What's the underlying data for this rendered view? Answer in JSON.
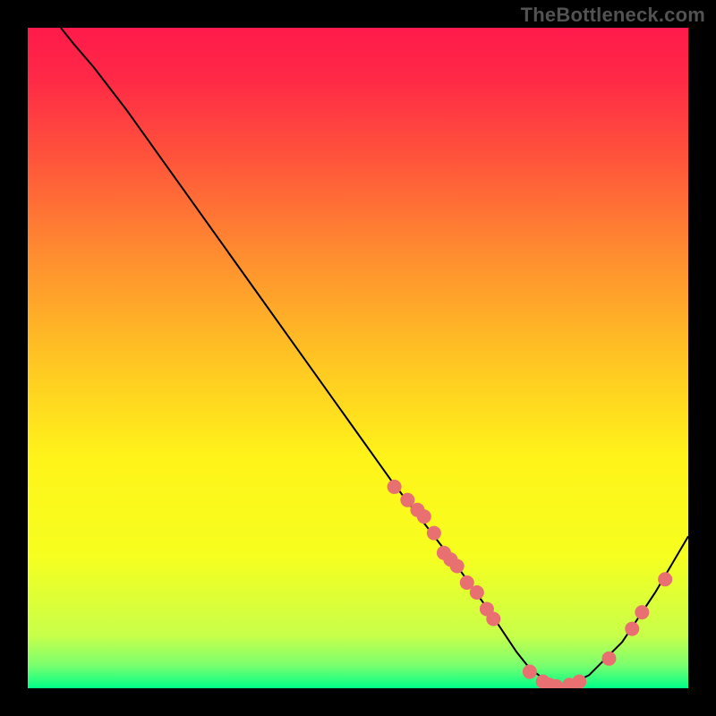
{
  "attribution": "TheBottleneck.com",
  "chart_data": {
    "type": "line",
    "title": "",
    "xlabel": "",
    "ylabel": "",
    "xlim": [
      0,
      100
    ],
    "ylim": [
      0,
      100
    ],
    "series": [
      {
        "name": "bottleneck-curve",
        "x": [
          5.0,
          7.0,
          10.0,
          15.0,
          20.0,
          25.0,
          30.0,
          35.0,
          40.0,
          45.0,
          50.0,
          55.0,
          60.0,
          65.0,
          70.0,
          72.0,
          74.0,
          76.0,
          78.0,
          80.0,
          82.0,
          85.0,
          90.0,
          95.0,
          100.0
        ],
        "y": [
          100.0,
          97.5,
          94.0,
          87.5,
          80.5,
          73.5,
          66.5,
          59.5,
          52.5,
          45.5,
          38.5,
          31.5,
          25.0,
          18.5,
          11.5,
          8.5,
          5.5,
          3.0,
          1.5,
          0.5,
          0.5,
          2.0,
          7.0,
          14.5,
          23.0
        ]
      }
    ],
    "markers": {
      "name": "highlighted-points",
      "points": [
        {
          "x": 55.5,
          "y": 30.5
        },
        {
          "x": 57.5,
          "y": 28.5
        },
        {
          "x": 59.0,
          "y": 27.0
        },
        {
          "x": 60.0,
          "y": 26.0
        },
        {
          "x": 61.5,
          "y": 23.5
        },
        {
          "x": 63.0,
          "y": 20.5
        },
        {
          "x": 64.0,
          "y": 19.5
        },
        {
          "x": 65.0,
          "y": 18.5
        },
        {
          "x": 66.5,
          "y": 16.0
        },
        {
          "x": 68.0,
          "y": 14.5
        },
        {
          "x": 69.5,
          "y": 12.0
        },
        {
          "x": 70.5,
          "y": 10.5
        },
        {
          "x": 76.0,
          "y": 2.5
        },
        {
          "x": 78.0,
          "y": 1.0
        },
        {
          "x": 79.0,
          "y": 0.5
        },
        {
          "x": 80.0,
          "y": 0.3
        },
        {
          "x": 82.0,
          "y": 0.5
        },
        {
          "x": 83.5,
          "y": 1.0
        },
        {
          "x": 88.0,
          "y": 4.5
        },
        {
          "x": 91.5,
          "y": 9.0
        },
        {
          "x": 93.0,
          "y": 11.5
        },
        {
          "x": 96.5,
          "y": 16.5
        }
      ]
    },
    "gradient_stops": [
      {
        "offset": 0.0,
        "color": "#ff1a4b"
      },
      {
        "offset": 0.08,
        "color": "#ff2a46"
      },
      {
        "offset": 0.2,
        "color": "#ff553b"
      },
      {
        "offset": 0.35,
        "color": "#ff8f2f"
      },
      {
        "offset": 0.5,
        "color": "#ffc423"
      },
      {
        "offset": 0.65,
        "color": "#fff31a"
      },
      {
        "offset": 0.8,
        "color": "#f6ff1f"
      },
      {
        "offset": 0.92,
        "color": "#c8ff4a"
      },
      {
        "offset": 0.965,
        "color": "#7bff6e"
      },
      {
        "offset": 1.0,
        "color": "#00ff88"
      }
    ],
    "curve_color": "#000000",
    "marker_color": "#e87070",
    "marker_radius_px": 8
  }
}
